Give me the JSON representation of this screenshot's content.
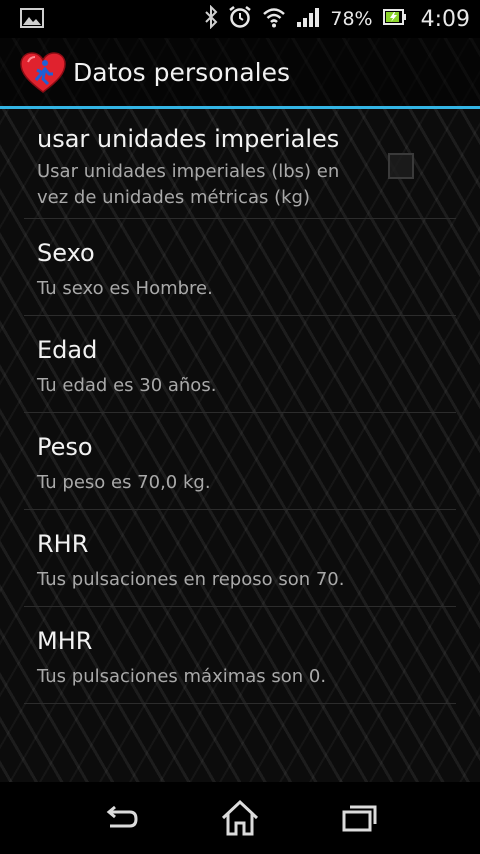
{
  "status_bar": {
    "left_icon": "image-notification-icon",
    "icons": [
      "bluetooth-icon",
      "alarm-clock-icon",
      "wifi-icon",
      "signal-icon"
    ],
    "battery_percent": "78%",
    "battery_icon": "battery-charging-icon",
    "time": "4:09"
  },
  "action_bar": {
    "title": "Datos personales",
    "app_icon": "heart-runner-icon",
    "accent_color": "#33b5e5"
  },
  "preferences": [
    {
      "title": "usar unidades imperiales",
      "summary": "Usar unidades imperiales (lbs) en vez de unidades métricas (kg)",
      "checked": false
    },
    {
      "title": "Sexo",
      "summary": "Tu sexo es Hombre."
    },
    {
      "title": "Edad",
      "summary": "Tu edad es 30 años."
    },
    {
      "title": "Peso",
      "summary": "Tu peso es 70,0 kg."
    },
    {
      "title": "RHR",
      "summary": "Tus pulsaciones en reposo son 70."
    },
    {
      "title": "MHR",
      "summary": "Tus pulsaciones máximas son 0."
    }
  ],
  "nav_bar": {
    "buttons": [
      "back-icon",
      "home-icon",
      "recent-apps-icon"
    ]
  }
}
